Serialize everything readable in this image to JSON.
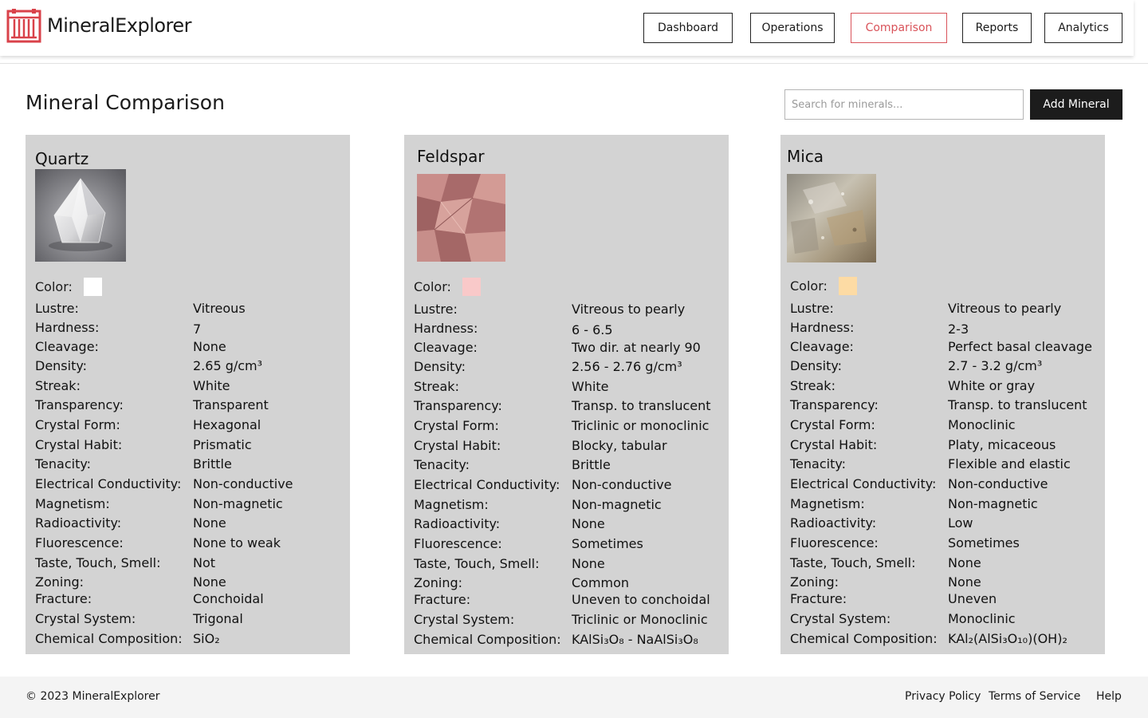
{
  "brand": "MineralExplorer",
  "nav": [
    {
      "label": "Dashboard",
      "active": false
    },
    {
      "label": "Operations",
      "active": false
    },
    {
      "label": "Comparison",
      "active": true
    },
    {
      "label": "Reports",
      "active": false
    },
    {
      "label": "Analytics",
      "active": false
    }
  ],
  "page_title": "Mineral Comparison",
  "search": {
    "placeholder": "Search for minerals..."
  },
  "add_button": "Add Mineral",
  "color_label": "Color:",
  "labels": [
    "Lustre:",
    "Hardness:",
    "Cleavage:",
    "Density:",
    "Streak:",
    "Transparency:",
    "Crystal Form:",
    "Crystal Habit:",
    "Tenacity:",
    "Electrical Conductivity:",
    "Magnetism:",
    "Radioactivity:",
    "Fluorescence:",
    "Taste, Touch, Smell:",
    "Zoning:",
    "Fracture:",
    "Crystal System:",
    "Chemical Composition:"
  ],
  "minerals": [
    {
      "name": "Quartz",
      "color": "#ffffff",
      "values": [
        "Vitreous",
        "7",
        "None",
        "2.65 g/cm³",
        "White",
        "Transparent",
        "Hexagonal",
        "Prismatic",
        "Brittle",
        "Non-conductive",
        "Non-magnetic",
        "None",
        "None to weak",
        "Not",
        "None",
        "Conchoidal",
        "Trigonal",
        "SiO₂"
      ]
    },
    {
      "name": "Feldspar",
      "color": "#f9c9c9",
      "values": [
        "Vitreous to pearly",
        "6 - 6.5",
        "Two dir. at nearly 90",
        "2.56 - 2.76 g/cm³",
        "White",
        "Transp. to translucent",
        "Triclinic or monoclinic",
        "Blocky, tabular",
        "Brittle",
        "Non-conductive",
        "Non-magnetic",
        "None",
        "Sometimes",
        "None",
        "Common",
        "Uneven to conchoidal",
        "Triclinic or Monoclinic",
        "KAlSi₃O₈ - NaAlSi₃O₈"
      ]
    },
    {
      "name": "Mica",
      "color": "#fddba4",
      "values": [
        "Vitreous to pearly",
        "2-3",
        "Perfect basal cleavage",
        "2.7 - 3.2 g/cm³",
        "White or gray",
        "Transp. to translucent",
        "Monoclinic",
        "Platy, micaceous",
        "Flexible and elastic",
        "Non-conductive",
        "Non-magnetic",
        "Low",
        "Sometimes",
        "None",
        "None",
        "Uneven",
        "Monoclinic",
        "KAl₂(AlSi₃O₁₀)(OH)₂"
      ]
    }
  ],
  "footer": {
    "copyright": "© 2023 MineralExplorer",
    "links": [
      "Privacy Policy",
      "Terms of Service",
      "Help"
    ]
  }
}
